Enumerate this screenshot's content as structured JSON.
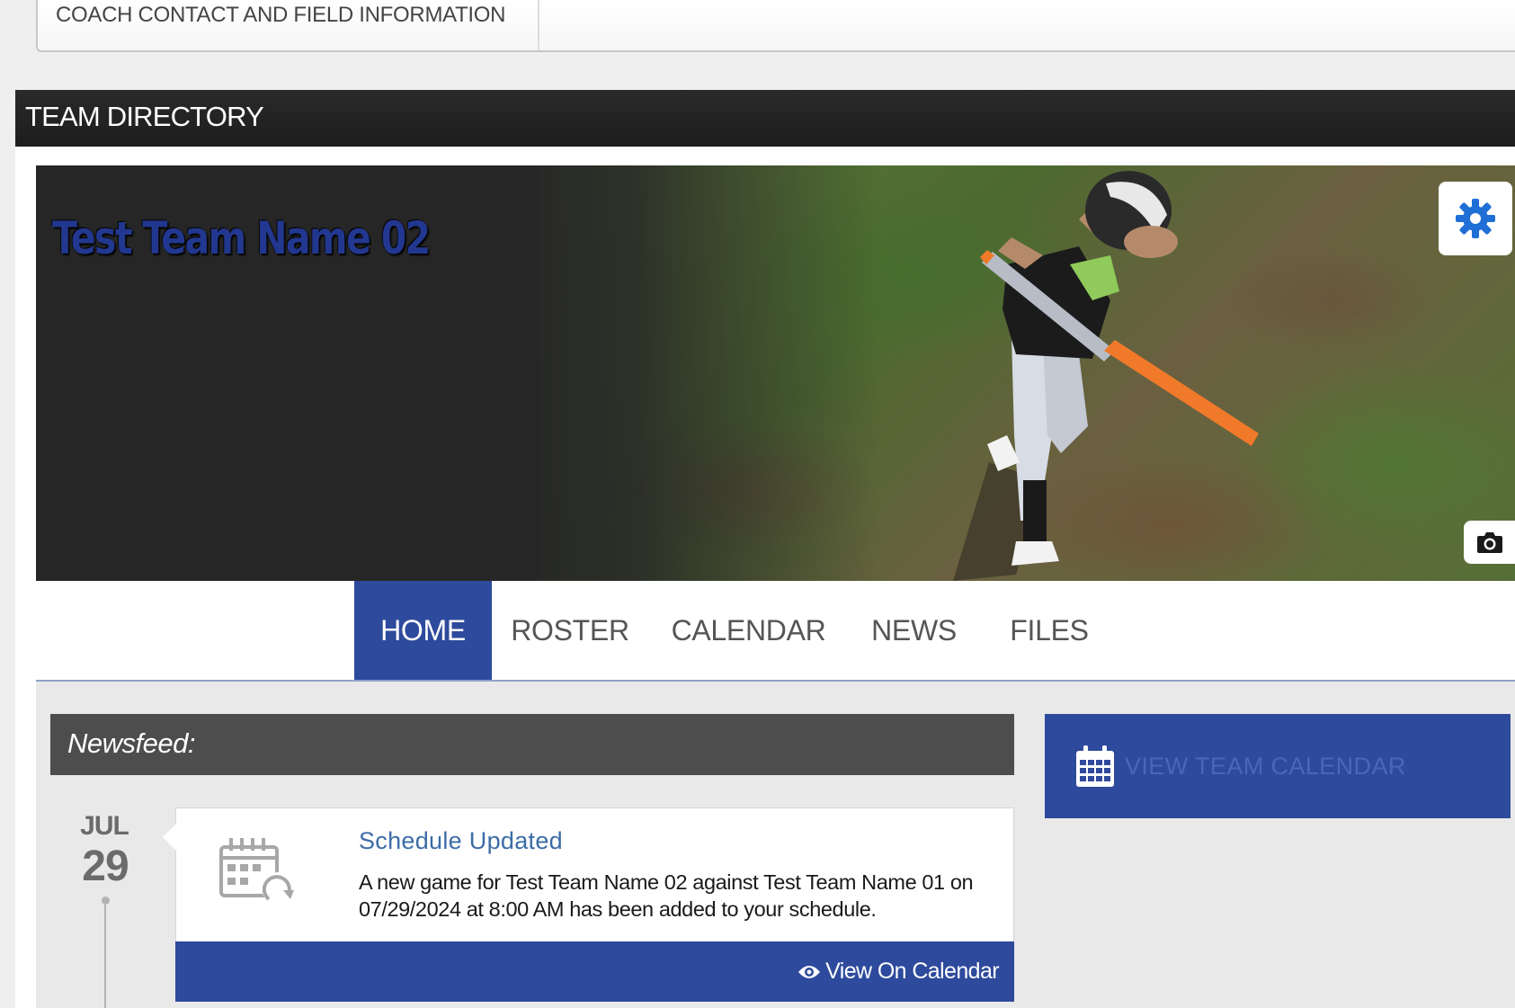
{
  "top_tab": {
    "label": "COACH CONTACT AND FIELD INFORMATION"
  },
  "directory": {
    "title": "TEAM DIRECTORY"
  },
  "banner": {
    "team_name": "Test Team Name 02",
    "settings_icon": "gear-icon",
    "camera_icon": "camera-icon"
  },
  "nav": {
    "items": [
      {
        "label": "HOME",
        "active": true
      },
      {
        "label": "ROSTER",
        "active": false
      },
      {
        "label": "CALENDAR",
        "active": false
      },
      {
        "label": "NEWS",
        "active": false
      },
      {
        "label": "FILES",
        "active": false
      }
    ]
  },
  "newsfeed": {
    "heading": "Newsfeed:",
    "entries": [
      {
        "month": "JUL",
        "day": "29",
        "icon": "calendar-refresh-icon",
        "title": "Schedule Updated",
        "body": "A new game for Test Team Name 02 against Test Team Name 01 on 07/29/2024 at 8:00 AM has been added to your schedule.",
        "action_label": "View On Calendar",
        "action_icon": "eye-icon"
      }
    ]
  },
  "sidebar": {
    "view_calendar_label": "VIEW TEAM CALENDAR",
    "view_calendar_icon": "calendar-icon"
  },
  "colors": {
    "brand_blue": "#2e4a9c",
    "dark_bar": "#1d1d1d",
    "newsfeed_bar": "#4d4d4d",
    "link_blue": "#3c6ca6",
    "settings_blue": "#1f6fd6"
  }
}
